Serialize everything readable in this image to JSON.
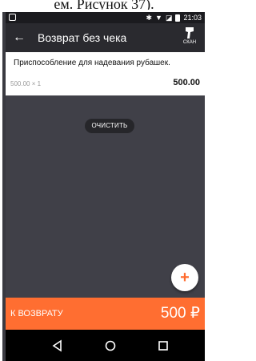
{
  "caption": "ем. Рисунок 37).",
  "status_bar": {
    "time": "21:03"
  },
  "app_bar": {
    "title": "Возврат без чека",
    "scan_label": "СКАН"
  },
  "item": {
    "name": "Приспособление для надевания рубашек.",
    "price_qty": "500.00 × 1",
    "total": "500.00"
  },
  "clear_button": "ОЧИСТИТЬ",
  "fab_label": "+",
  "bottom_bar": {
    "label": "К ВОЗВРАТУ",
    "amount": "500 ₽"
  },
  "colors": {
    "accent": "#ff6e31",
    "background": "#404048",
    "appbar": "#2a2a2f"
  },
  "icons": [
    "back-arrow-icon",
    "scanner-icon",
    "bluetooth-icon",
    "wifi-icon",
    "battery-icon",
    "nav-back-icon",
    "nav-home-icon",
    "nav-recent-icon"
  ]
}
